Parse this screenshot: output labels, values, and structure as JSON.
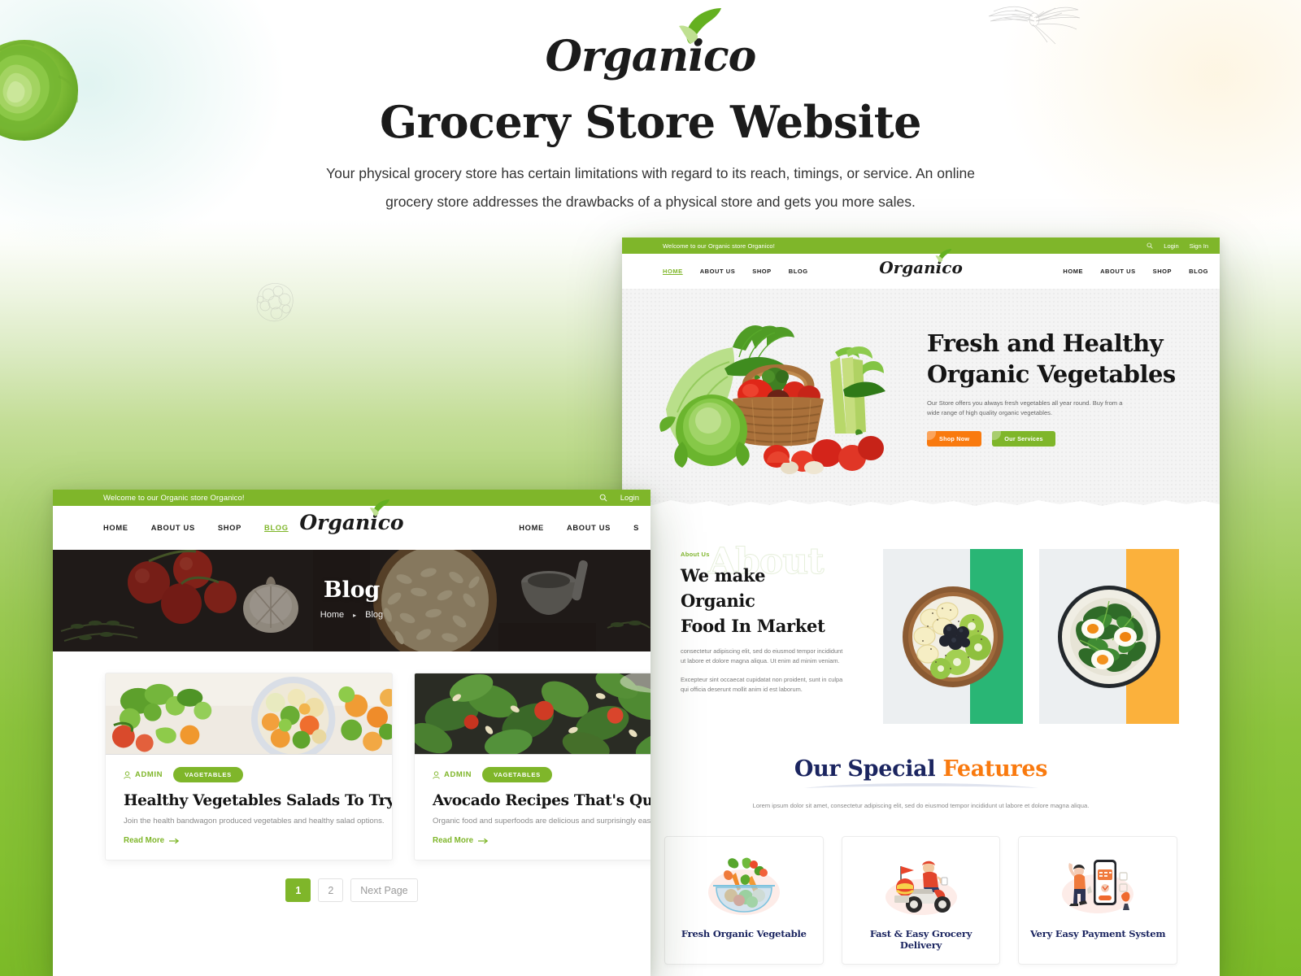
{
  "hero": {
    "brand": "Organico",
    "title": "Grocery Store Website",
    "subtitle": "Your physical grocery store has certain limitations with regard to its reach, timings, or service. An online grocery store addresses the drawbacks of a physical store and gets you more sales."
  },
  "mock_home": {
    "topbar": {
      "welcome": "Welcome to our Organic store Organico!",
      "search_icon": "search-icon",
      "login": "Login",
      "signin": "Sign In"
    },
    "nav_left": [
      {
        "label": "HOME",
        "active": true
      },
      {
        "label": "ABOUT US",
        "active": false
      },
      {
        "label": "SHOP",
        "active": false
      },
      {
        "label": "BLOG",
        "active": false
      }
    ],
    "nav_right": [
      {
        "label": "HOME"
      },
      {
        "label": "ABOUT US"
      },
      {
        "label": "SHOP"
      },
      {
        "label": "BLOG"
      }
    ],
    "brand": "Organico",
    "hero": {
      "title_line1": "Fresh and Healthy",
      "title_line2": "Organic Vegetables",
      "paragraph": "Our Store offers you always fresh vegetables all year round. Buy from a wide range of high quality organic vegetables.",
      "btn_primary": "Shop Now",
      "btn_secondary": "Our Services",
      "image_name": "vegetable-basket-photo"
    },
    "about": {
      "watermark": "About",
      "kicker": "About Us",
      "title_line1": "We make Organic",
      "title_line2": "Food In Market",
      "paragraph1": "consectetur adipiscing elit, sed do eiusmod tempor incididunt ut labore et dolore magna aliqua. Ut enim ad minim veniam.",
      "paragraph2": "Excepteur sint occaecat cupidatat non proident, sunt in culpa qui officia deserunt mollit anim id est laborum.",
      "image_1_name": "fruit-bowl-photo",
      "image_2_name": "spinach-egg-salad-photo",
      "accent_1": "#29b675",
      "accent_2": "#fbb13c"
    },
    "features": {
      "title_dark": "Our Special",
      "title_accent": "Features",
      "subtitle": "Lorem ipsum dolor sit amet, consectetur adipiscing elit, sed do eiusmod tempor incididunt ut labore et dolore magna aliqua.",
      "cards": [
        {
          "title": "Fresh Organic Vegetable",
          "icon": "vegetable-bowl-illustration"
        },
        {
          "title": "Fast & Easy Grocery Delivery",
          "icon": "scooter-delivery-illustration"
        },
        {
          "title": "Very Easy Payment System",
          "icon": "mobile-payment-illustration"
        }
      ]
    }
  },
  "mock_blog": {
    "topbar": {
      "welcome": "Welcome to our Organic store Organico!",
      "search_icon": "search-icon",
      "login": "Login"
    },
    "nav_left": [
      {
        "label": "HOME",
        "active": false
      },
      {
        "label": "ABOUT US",
        "active": false
      },
      {
        "label": "SHOP",
        "active": false
      },
      {
        "label": "BLOG",
        "active": true
      }
    ],
    "nav_right": [
      {
        "label": "HOME"
      },
      {
        "label": "ABOUT US"
      },
      {
        "label": "S"
      }
    ],
    "brand": "Organico",
    "banner": {
      "title": "Blog",
      "crumb_home": "Home",
      "crumb_sep": "▸",
      "crumb_current": "Blog",
      "image_name": "dark-food-ingredients-photo"
    },
    "posts": [
      {
        "author": "ADMIN",
        "category": "VAGETABLES",
        "title": "Healthy Vegetables Salads To Try",
        "excerpt": "Join the health bandwagon produced vegetables and healthy salad options.",
        "read_more": "Read More",
        "thumb_name": "vegetable-salad-bowl-photo"
      },
      {
        "author": "ADMIN",
        "category": "VAGETABLES",
        "title": "Avocado Recipes That's Quick",
        "excerpt": "Organic food and superfoods are delicious and surprisingly easy",
        "read_more": "Read More",
        "thumb_name": "green-salad-photo"
      }
    ],
    "pagination": [
      {
        "label": "1",
        "active": true
      },
      {
        "label": "2",
        "active": false
      },
      {
        "label": "Next Page",
        "active": false
      }
    ]
  },
  "colors": {
    "brand_green": "#7fb62a",
    "accent_orange": "#f97a0f",
    "navy": "#1b2560"
  }
}
